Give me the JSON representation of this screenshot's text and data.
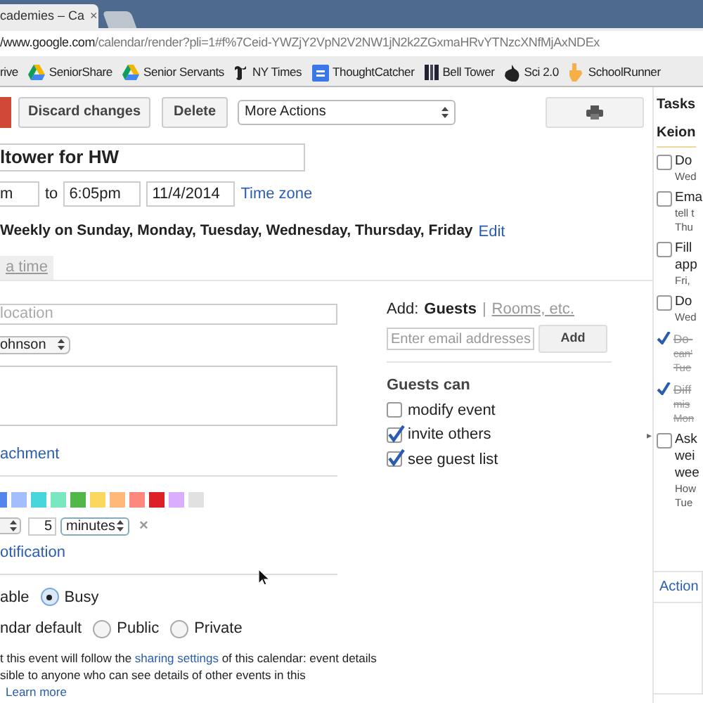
{
  "browser": {
    "tab_title": "cademies – Ca",
    "tab_close": "×",
    "url_host": "/www.google.com",
    "url_path": "/calendar/render?pli=1#f%7Ceid-YWZjY2VpN2V2NW1jN2k2ZGxmaHRvYTNzcXNfMjAxNDEx"
  },
  "bookmarks": [
    {
      "label": "rive",
      "kind": "none"
    },
    {
      "label": "SeniorShare",
      "kind": "drive"
    },
    {
      "label": "Senior Servants",
      "kind": "drive"
    },
    {
      "label": "NY Times",
      "kind": "nyt"
    },
    {
      "label": "ThoughtCatcher",
      "kind": "doc"
    },
    {
      "label": "Bell Tower",
      "kind": "bars"
    },
    {
      "label": "Sci 2.0",
      "kind": "blob"
    },
    {
      "label": "SchoolRunner",
      "kind": "hand"
    }
  ],
  "toolbar": {
    "buttons": [
      "Discard changes",
      "Delete"
    ],
    "more_actions": "More Actions"
  },
  "event": {
    "title": "ltower for HW",
    "start_time": "m",
    "to": "to",
    "end_time": "6:05pm",
    "date": "11/4/2014",
    "time_zone": "Time zone",
    "recurrence": "Weekly on Sunday, Monday, Tuesday, Wednesday, Thursday, Friday",
    "edit": "Edit"
  },
  "tabs": [
    {
      "label": "a time",
      "selected": false
    }
  ],
  "details": {
    "location_placeholder": "location",
    "calendar": "ohnson",
    "attachment_link": "achment"
  },
  "colors": [
    {
      "color": "#5484ed"
    },
    {
      "color": "#a4bdfc"
    },
    {
      "color": "#46d6db"
    },
    {
      "color": "#7ae7bf"
    },
    {
      "color": "#51b749"
    },
    {
      "color": "#fbd75b"
    },
    {
      "color": "#ffb878"
    },
    {
      "color": "#ff887c"
    },
    {
      "color": "#dc2127"
    },
    {
      "color": "#dbadff"
    },
    {
      "color": "#e1e1e1"
    }
  ],
  "notification": {
    "amount": "5",
    "unit": "minutes",
    "remove": "×",
    "add_link": "otification"
  },
  "availability": {
    "cut_label": "able",
    "options": [
      {
        "label": "Busy",
        "selected": true
      }
    ]
  },
  "privacy": {
    "cut_label": "ndar default",
    "options": [
      {
        "label": "Public",
        "selected": false
      },
      {
        "label": "Private",
        "selected": false
      }
    ]
  },
  "sharing_note": {
    "before": "t this event will follow the ",
    "link": "sharing settings",
    "after": " of this calendar: event details",
    "line2": "sible to anyone who can see details of other events in this",
    "learn_more": "Learn more"
  },
  "guests": {
    "add_label": "Add:",
    "guests_tab": "Guests",
    "separator": "|",
    "rooms_link": "Rooms, etc.",
    "email_placeholder": "Enter email addresses",
    "add_button": "Add",
    "permissions_title": "Guests can",
    "permissions": [
      {
        "label": "modify event",
        "checked": false
      },
      {
        "label": "invite others",
        "checked": true
      },
      {
        "label": "see guest list",
        "checked": true
      }
    ]
  },
  "collapse_handle": "▸",
  "tasks": {
    "title": "Tasks",
    "list": "Keion",
    "actions": "Action",
    "items": [
      {
        "checked": false,
        "title": [
          "Do"
        ],
        "details": [
          "Wed"
        ]
      },
      {
        "checked": false,
        "title": [
          "Ema"
        ],
        "details": [
          "tell t",
          "Thu"
        ]
      },
      {
        "checked": false,
        "title": [
          "Fill",
          "app"
        ],
        "details": [
          "Fri,"
        ]
      },
      {
        "checked": false,
        "title": [
          "Do"
        ],
        "details": [
          "Wed"
        ]
      },
      {
        "checked": true,
        "title": [
          "Do-"
        ],
        "details": [
          "can'",
          "Tue"
        ]
      },
      {
        "checked": true,
        "title": [
          "Diff"
        ],
        "details": [
          "mis",
          "Mon"
        ]
      },
      {
        "checked": false,
        "title": [
          "Ask",
          "wei",
          "wee"
        ],
        "details": [
          "How",
          "Tue"
        ]
      }
    ]
  }
}
